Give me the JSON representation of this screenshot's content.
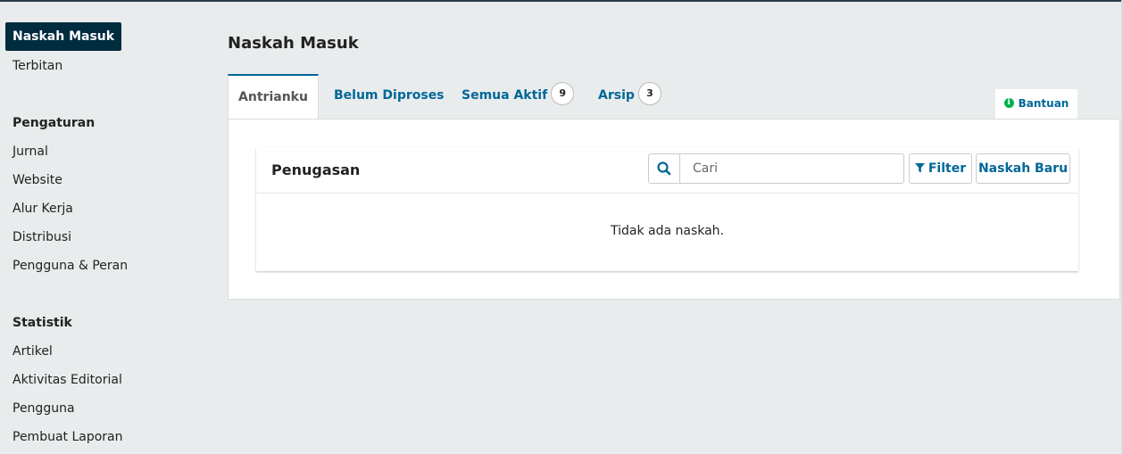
{
  "sidebar": {
    "active_item": "Naskah Masuk",
    "items": [
      "Terbitan"
    ],
    "sections": [
      {
        "heading": "Pengaturan",
        "items": [
          "Jurnal",
          "Website",
          "Alur Kerja",
          "Distribusi",
          "Pengguna & Peran"
        ]
      },
      {
        "heading": "Statistik",
        "items": [
          "Artikel",
          "Aktivitas Editorial",
          "Pengguna",
          "Pembuat Laporan"
        ]
      }
    ]
  },
  "main": {
    "title": "Naskah Masuk",
    "tabs": [
      {
        "label": "Antrianku"
      },
      {
        "label": "Belum Diproses"
      },
      {
        "label": "Semua Aktif",
        "badge": "9"
      },
      {
        "label": "Arsip",
        "badge": "3"
      }
    ],
    "help_label": "Bantuan",
    "list": {
      "title": "Penugasan",
      "search_placeholder": "Cari",
      "filter_label": "Filter",
      "new_label": "Naskah Baru",
      "empty_message": "Tidak ada naskah."
    }
  },
  "colors": {
    "accent": "#006798",
    "sidebar_active_bg": "#002c40",
    "help_icon": "#00b24e",
    "background": "#e9ecec"
  },
  "icons": {
    "search": "search-icon",
    "filter": "filter-icon",
    "help": "info-icon"
  }
}
